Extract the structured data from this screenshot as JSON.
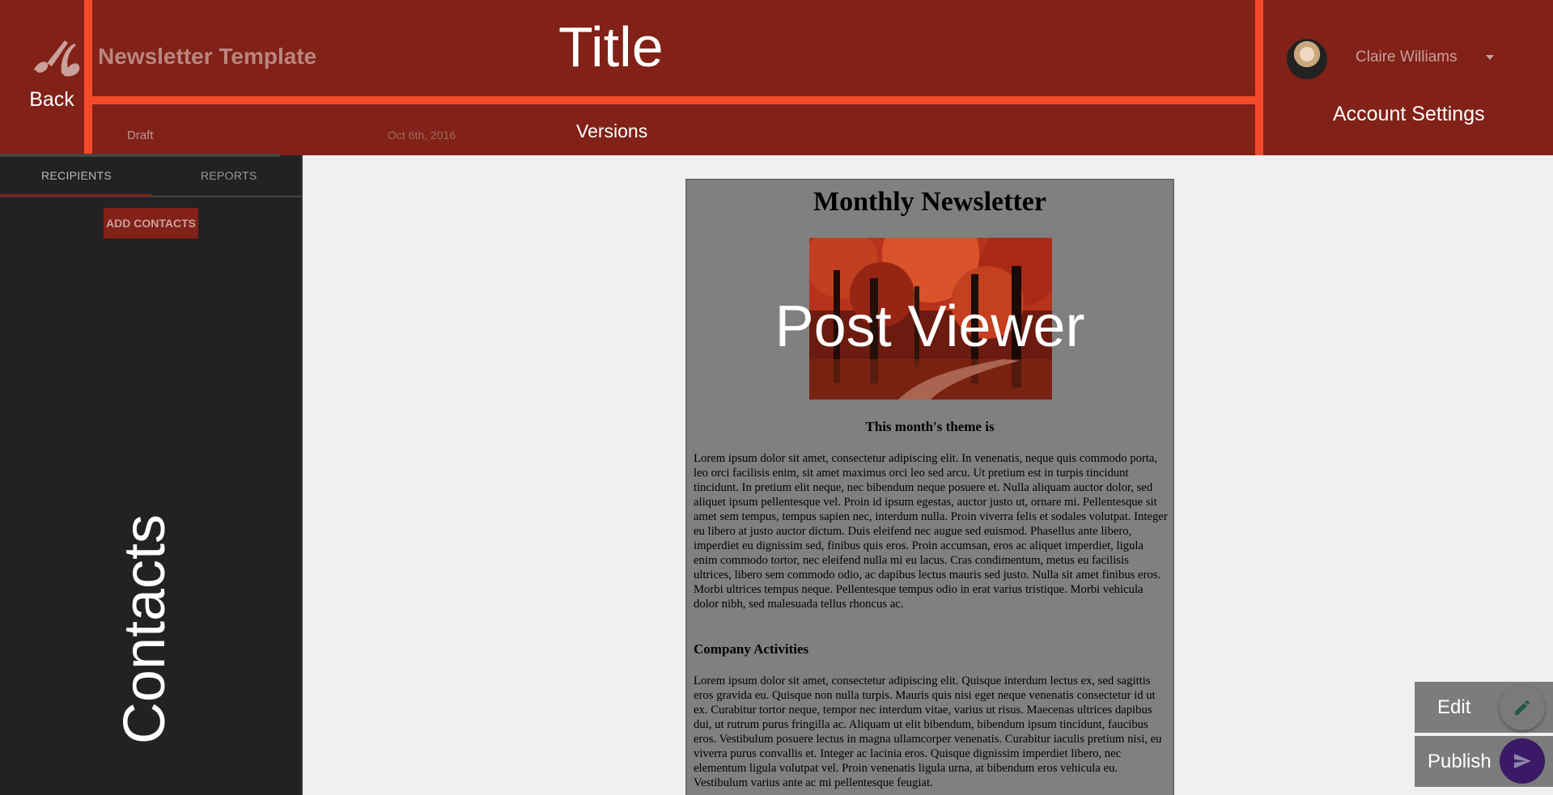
{
  "header": {
    "back_label": "Back",
    "app_title": "Newsletter Template",
    "section_title": "Title",
    "status": "Draft",
    "date": "Oct 6th, 2016",
    "versions_label": "Versions",
    "user_name": "Claire Williams",
    "account_settings_label": "Account Settings"
  },
  "sidebar": {
    "tabs": [
      {
        "label": "RECIPIENTS",
        "active": true
      },
      {
        "label": "REPORTS",
        "active": false
      }
    ],
    "add_contacts_label": "ADD CONTACTS",
    "section_label": "Contacts"
  },
  "post": {
    "overlay_label": "Post Viewer",
    "title": "Monthly Newsletter",
    "theme_heading": "This month's theme is",
    "paragraph_1": "Lorem ipsum dolor sit amet, consectetur adipiscing elit. In venenatis, neque quis commodo porta, leo orci facilisis enim, sit amet maximus orci leo sed arcu. Ut pretium est in turpis tincidunt tincidunt. In pretium elit neque, nec bibendum neque posuere et. Nulla aliquam auctor dolor, sed aliquet ipsum pellentesque vel. Proin id ipsum egestas, auctor justo ut, ornare mi. Pellentesque sit amet sem tempus, tempus sapien nec, interdum nulla. Proin viverra felis et sodales volutpat. Integer eu libero at justo auctor dictum. Duis eleifend nec augue sed euismod. Phasellus ante libero, imperdiet eu dignissim sed, finibus quis eros. Proin accumsan, eros ac aliquet imperdiet, ligula enim commodo tortor, nec eleifend nulla mi eu lacus. Cras condimentum, metus eu facilisis ultrices, libero sem commodo odio, ac dapibus lectus mauris sed justo. Nulla sit amet finibus eros. Morbi ultrices tempus neque. Pellentesque tempus odio in erat varius tristique. Morbi vehicula dolor nibh, sed malesuada tellus rhoncus ac.",
    "section_heading": "Company Activities",
    "paragraph_2": "Lorem ipsum dolor sit amet, consectetur adipiscing elit. Quisque interdum lectus ex, sed sagittis eros gravida eu. Quisque non nulla turpis. Mauris quis nisi eget neque venenatis consectetur id ut ex. Curabitur tortor neque, tempor nec interdum vitae, varius ut risus. Maecenas ultrices dapibus dui, ut rutrum purus fringilla ac. Aliquam ut elit bibendum, bibendum ipsum tincidunt, faucibus eros. Vestibulum posuere lectus in magna ullamcorper venenatis. Curabitur iaculis pretium nisi, eu viverra purus convallis et. Integer ac lacinia eros. Quisque dignissim imperdiet libero, nec elementum ligula volutpat vel. Proin venenatis ligula urna, at bibendum eros vehicula eu. Vestibulum varius ante ac mi pellentesque feugiat."
  },
  "actions": {
    "edit_label": "Edit",
    "publish_label": "Publish"
  },
  "colors": {
    "header_bg": "#812117",
    "highlight_line": "#f54a2a",
    "sidebar_bg": "#222222",
    "publish_fab": "#3a1a66"
  },
  "icons": [
    "brush-logo-icon",
    "dropdown-caret-icon",
    "pencil-icon",
    "send-icon"
  ]
}
